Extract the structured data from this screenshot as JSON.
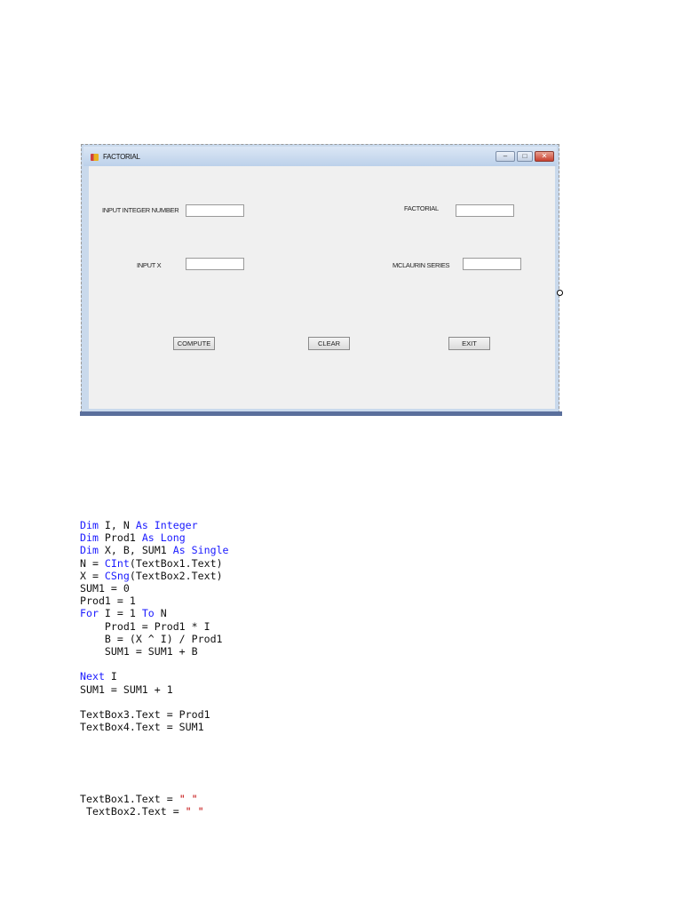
{
  "window": {
    "title": "FACTORIAL",
    "controls": {
      "minimize": "–",
      "maximize": "□",
      "close": "✕"
    },
    "fields": {
      "input_integer_label": "INPUT INTEGER NUMBER",
      "input_integer_value": "",
      "input_x_label": "INPUT X",
      "input_x_value": "",
      "factorial_label": "FACTORIAL",
      "factorial_value": "",
      "mclaurin_label": "MCLAURIN SERIES",
      "mclaurin_value": ""
    },
    "buttons": {
      "compute": "COMPUTE",
      "clear": "CLEAR",
      "exit": "EXIT"
    }
  },
  "code_compute": [
    [
      [
        "kw",
        "Dim"
      ],
      [
        "p",
        " I, N "
      ],
      [
        "kw",
        "As Integer"
      ]
    ],
    [
      [
        "kw",
        "Dim"
      ],
      [
        "p",
        " Prod1 "
      ],
      [
        "kw",
        "As Long"
      ]
    ],
    [
      [
        "kw",
        "Dim"
      ],
      [
        "p",
        " X, B, SUM1 "
      ],
      [
        "kw",
        "As Single"
      ]
    ],
    [
      [
        "p",
        "N = "
      ],
      [
        "kw",
        "CInt"
      ],
      [
        "p",
        "(TextBox1.Text)"
      ]
    ],
    [
      [
        "p",
        "X = "
      ],
      [
        "kw",
        "CSng"
      ],
      [
        "p",
        "(TextBox2.Text)"
      ]
    ],
    [
      [
        "p",
        "SUM1 = 0"
      ]
    ],
    [
      [
        "p",
        "Prod1 = 1"
      ]
    ],
    [
      [
        "kw",
        "For"
      ],
      [
        "p",
        " I = 1 "
      ],
      [
        "kw",
        "To"
      ],
      [
        "p",
        " N"
      ]
    ],
    [
      [
        "p",
        "    Prod1 = Prod1 * I"
      ]
    ],
    [
      [
        "p",
        "    B = (X ^ I) / Prod1"
      ]
    ],
    [
      [
        "p",
        "    SUM1 = SUM1 + B"
      ]
    ],
    [],
    [
      [
        "kw",
        "Next"
      ],
      [
        "p",
        " I"
      ]
    ],
    [
      [
        "p",
        "SUM1 = SUM1 + 1"
      ]
    ],
    [],
    [
      [
        "p",
        "TextBox3.Text = Prod1"
      ]
    ],
    [
      [
        "p",
        "TextBox4.Text = SUM1"
      ]
    ]
  ],
  "code_clear": [
    [
      [
        "p",
        "TextBox1.Text = "
      ],
      [
        "str",
        "\" \""
      ]
    ],
    [
      [
        "p",
        " TextBox2.Text = "
      ],
      [
        "str",
        "\" \""
      ]
    ]
  ]
}
